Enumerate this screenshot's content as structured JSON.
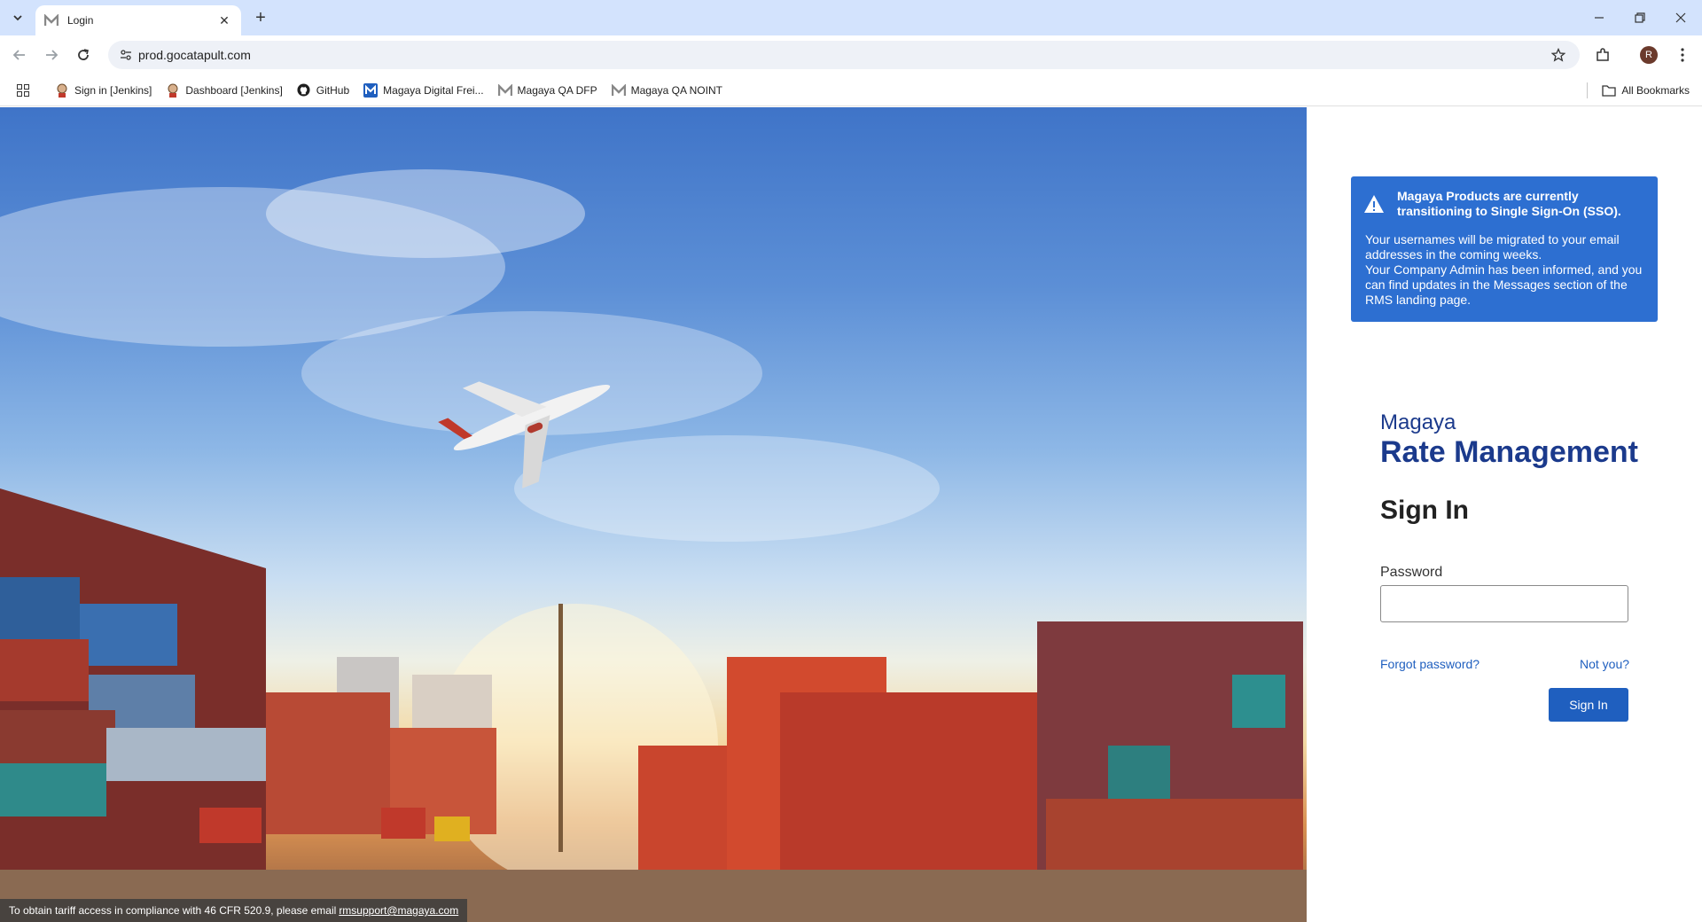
{
  "browser": {
    "tab_title": "Login",
    "url": "prod.gocatapult.com",
    "profile_initial": "R",
    "bookmarks": [
      {
        "label": "Sign in [Jenkins]",
        "icon": "jenkins-icon"
      },
      {
        "label": "Dashboard [Jenkins]",
        "icon": "jenkins-icon"
      },
      {
        "label": "GitHub",
        "icon": "github-icon"
      },
      {
        "label": "Magaya Digital Frei...",
        "icon": "magaya-icon"
      },
      {
        "label": "Magaya QA DFP",
        "icon": "magaya-icon"
      },
      {
        "label": "Magaya QA NOINT",
        "icon": "magaya-icon"
      }
    ],
    "all_bookmarks": "All Bookmarks"
  },
  "alert": {
    "heading": "Magaya Products are currently transitioning to Single Sign-On (SSO).",
    "body_line1": "Your usernames will be migrated to your email addresses in the coming weeks.",
    "body_line2": "Your Company Admin has been informed, and you can find updates in the Messages section of the RMS landing page.",
    "color": "#2d6fd1"
  },
  "login": {
    "brand_small": "Magaya",
    "brand_big": "Rate Management",
    "title": "Sign In",
    "password_label": "Password",
    "password_value": "",
    "forgot_link": "Forgot password?",
    "not_you_link": "Not you?",
    "sign_in_button": "Sign In",
    "accent": "#1f5fbf"
  },
  "footer": {
    "notice_text": "To obtain tariff access in compliance with 46 CFR 520.9, please email",
    "email": "rmsupport@magaya.com"
  }
}
